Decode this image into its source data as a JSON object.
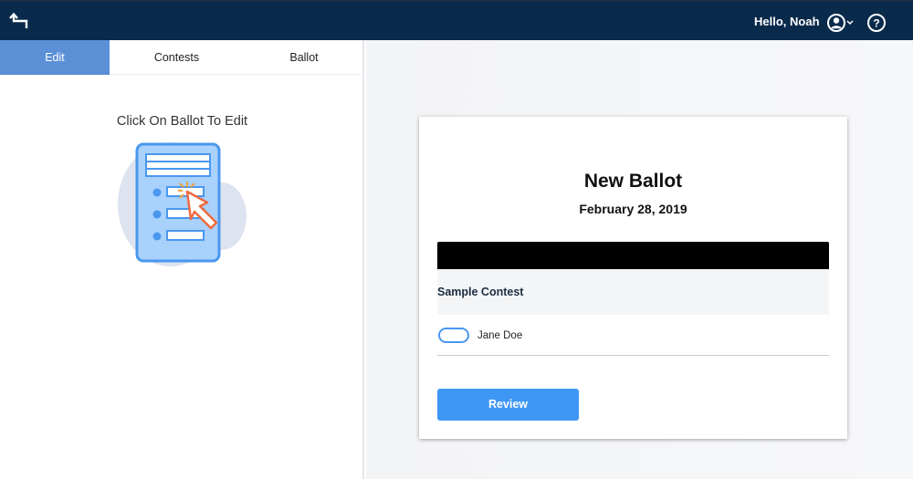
{
  "topbar": {
    "back_icon": "back-arrow-icon",
    "greeting": "Hello, Noah",
    "account_icon": "user-circle-icon",
    "help_icon": "question-circle-icon",
    "background_color": "#0a2a4c"
  },
  "sidebar": {
    "tabs": [
      {
        "label": "Edit",
        "active": true
      },
      {
        "label": "Contests",
        "active": false
      },
      {
        "label": "Ballot",
        "active": false
      }
    ],
    "hint": "Click On Ballot To Edit",
    "illustration_icon": "ballot-cursor-illustration",
    "active_tab_color": "#5b8fd6"
  },
  "ballot": {
    "title": "New Ballot",
    "date": "February 28, 2019",
    "contest": {
      "title": "Sample Contest",
      "candidates": [
        {
          "name": "Jane Doe",
          "selected": false
        }
      ]
    },
    "review_label": "Review",
    "accent_color": "#3f97f5"
  }
}
